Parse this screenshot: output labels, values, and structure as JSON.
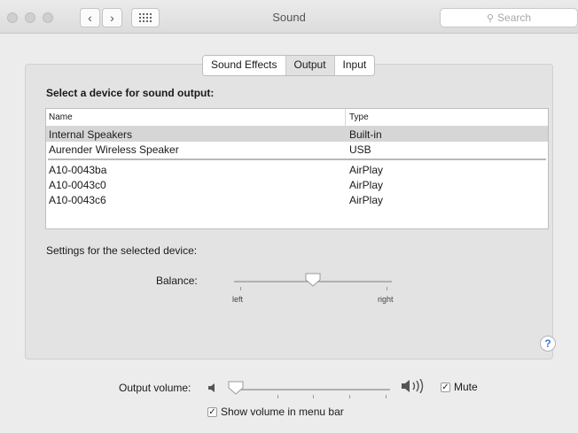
{
  "window": {
    "title": "Sound"
  },
  "search": {
    "placeholder": "Search"
  },
  "tabs": [
    {
      "label": "Sound Effects",
      "selected": false
    },
    {
      "label": "Output",
      "selected": true
    },
    {
      "label": "Input",
      "selected": false
    }
  ],
  "output": {
    "heading": "Select a device for sound output:",
    "columns": {
      "name": "Name",
      "type": "Type"
    },
    "devices": [
      {
        "name": "Internal Speakers",
        "type": "Built-in",
        "selected": true
      },
      {
        "name": "Aurender Wireless Speaker",
        "type": "USB",
        "selected": false
      },
      {
        "name": "A10-0043ba",
        "type": "AirPlay",
        "selected": false
      },
      {
        "name": "A10-0043c0",
        "type": "AirPlay",
        "selected": false
      },
      {
        "name": "A10-0043c6",
        "type": "AirPlay",
        "selected": false
      }
    ],
    "settings_label": "Settings for the selected device:",
    "balance": {
      "label": "Balance:",
      "left_label": "left",
      "right_label": "right",
      "value": 0.5
    }
  },
  "volume": {
    "label": "Output volume:",
    "level": 0.0,
    "mute_label": "Mute",
    "mute_checked": true,
    "menubar_label": "Show volume in menu bar",
    "menubar_checked": true
  },
  "icons": {
    "back": "chevron-left-icon",
    "forward": "chevron-right-icon",
    "grid": "grid-icon",
    "search": "search-icon",
    "speaker_low": "speaker-low-icon",
    "speaker_high": "speaker-high-icon",
    "help": "help-icon"
  },
  "colors": {
    "accent": "#3a78d8",
    "selection": "#d6d6d6"
  }
}
